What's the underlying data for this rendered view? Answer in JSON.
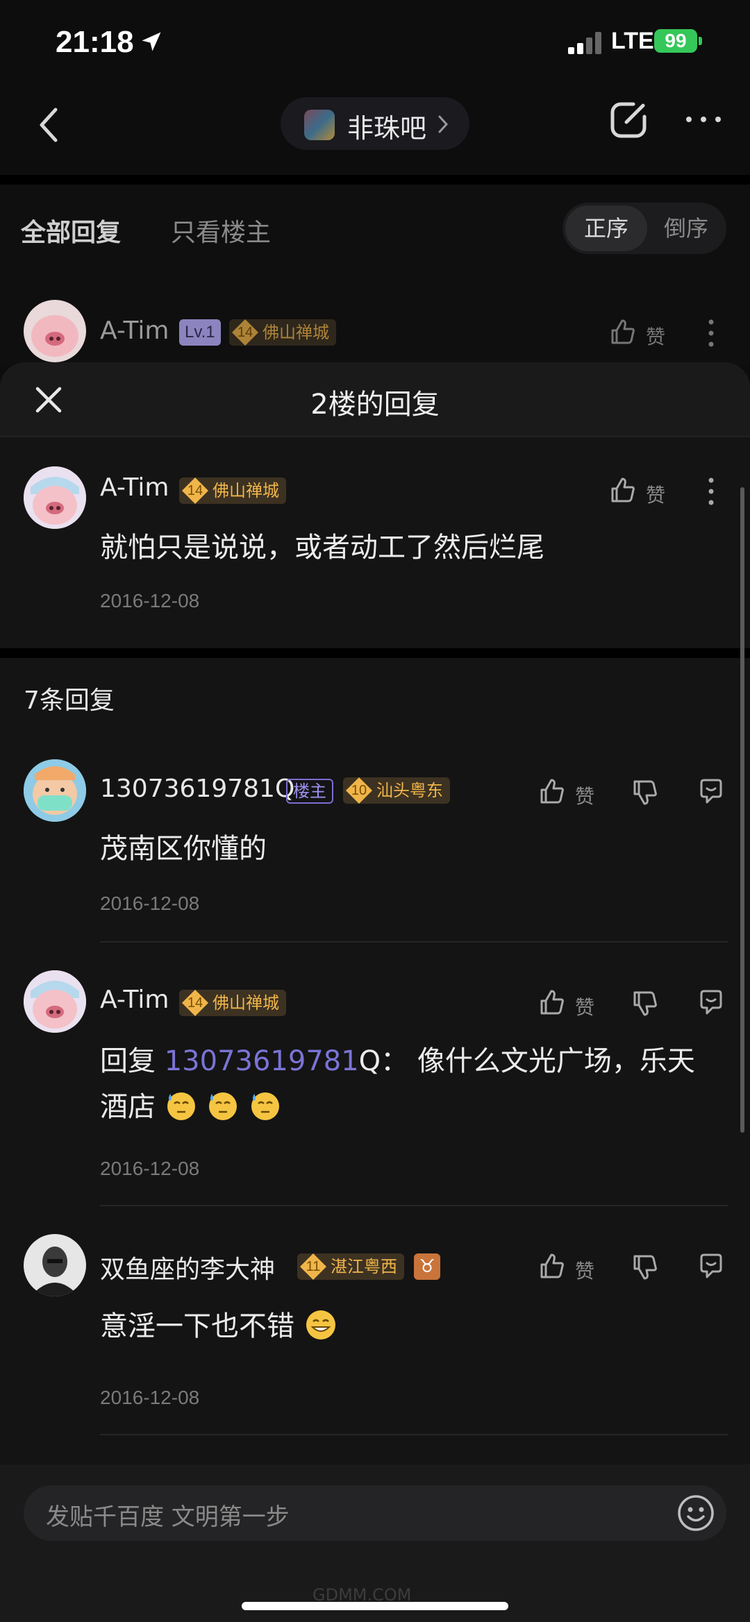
{
  "status_bar": {
    "time": "21:18",
    "network": "LTE",
    "battery": "99"
  },
  "nav": {
    "forum_name": "非珠吧"
  },
  "background": {
    "tab_all": "全部回复",
    "tab_op": "只看楼主",
    "sort_asc": "正序",
    "sort_desc": "倒序",
    "user": {
      "name": "A-Tim",
      "level": "Lv.1",
      "badge_level": "14",
      "badge_text": "佛山禅城",
      "like": "赞"
    }
  },
  "sheet": {
    "title": "2楼的回复",
    "main_post": {
      "name": "A-Tim",
      "badge_level": "14",
      "badge_text": "佛山禅城",
      "like": "赞",
      "content": "就怕只是说说，或者动工了然后烂尾",
      "date": "2016-12-08"
    },
    "replies_count": "7条回复",
    "replies": [
      {
        "name": "13073619781Q",
        "op_badge": "楼主",
        "badge_level": "10",
        "badge_text": "汕头粤东",
        "like": "赞",
        "content": "茂南区你懂的",
        "date": "2016-12-08"
      },
      {
        "name": "A-Tim",
        "badge_level": "14",
        "badge_text": "佛山禅城",
        "like": "赞",
        "content_prefix": "回复 ",
        "mention": "13073619781",
        "content_rest": "Q： 像什么文光广场，乐天",
        "content_line2": "酒店",
        "date": "2016-12-08"
      },
      {
        "name": "双鱼座的李大神",
        "badge_level": "11",
        "badge_text": "湛江粤西",
        "zodiac": "♉",
        "like": "赞",
        "content": "意淫一下也不错",
        "date": "2016-12-08"
      }
    ]
  },
  "input": {
    "placeholder": "发贴千百度 文明第一步"
  },
  "watermark": "GDMM.COM",
  "colors": {
    "background": "#0d0d0d",
    "sheet": "#141414",
    "accent_purple": "#7a74d6",
    "badge_gold": "#f0b54a",
    "battery_green": "#35c759"
  }
}
